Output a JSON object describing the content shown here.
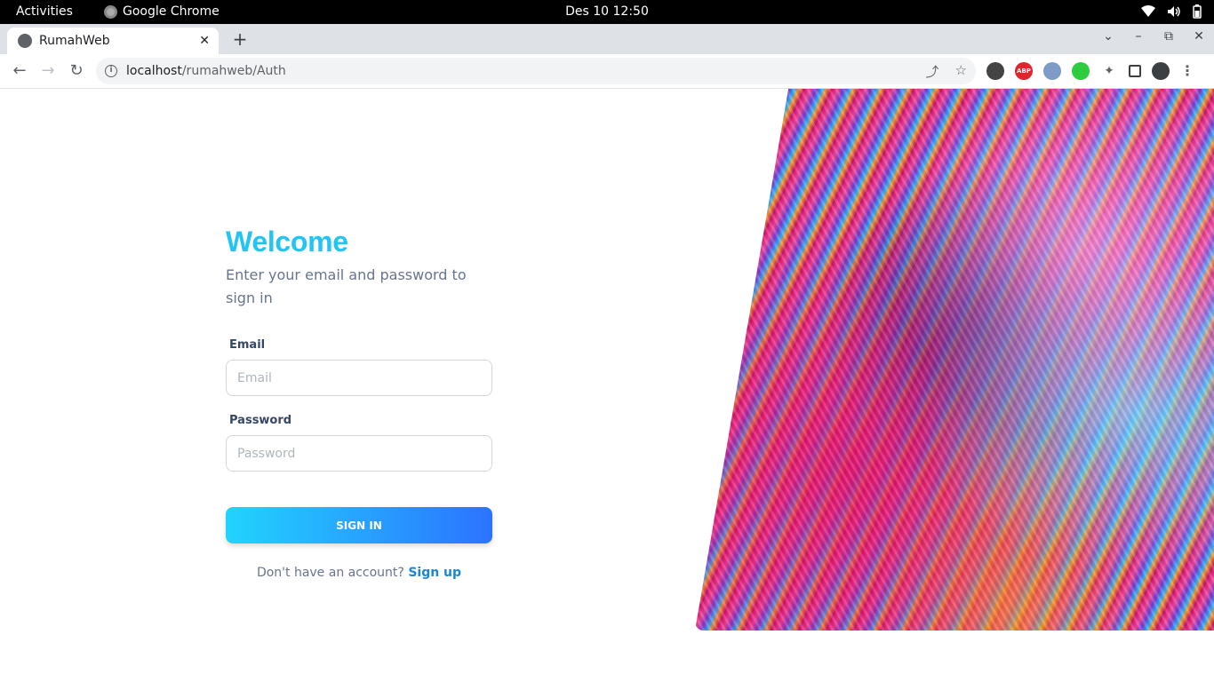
{
  "system_bar": {
    "activities": "Activities",
    "app_name": "Google Chrome",
    "clock": "Des 10  12:50"
  },
  "browser": {
    "tab_title": "RumahWeb",
    "tab_close": "✕",
    "new_tab": "+",
    "url_host": "localhost",
    "url_path": "/rumahweb/Auth"
  },
  "login": {
    "title": "Welcome",
    "subtitle": "Enter your email and password to sign in",
    "email_label": "Email",
    "email_placeholder": "Email",
    "password_label": "Password",
    "password_placeholder": "Password",
    "signin_button": "SIGN IN",
    "no_account_text": "Don't have an account?",
    "signup_link": "Sign up"
  },
  "colors": {
    "title": "#21c4f3",
    "button_gradient_start": "#21d4fd",
    "button_gradient_end": "#2c73ff",
    "link": "#1a87d6"
  }
}
